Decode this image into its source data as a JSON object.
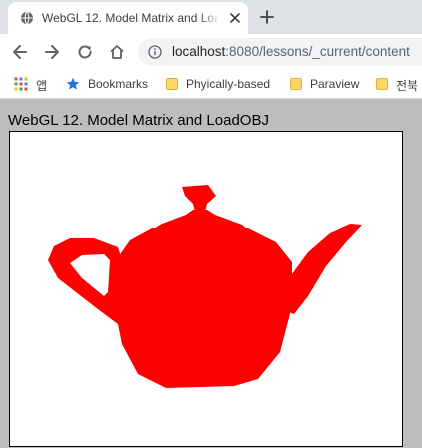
{
  "browser": {
    "tab": {
      "title": "WebGL 12. Model Matrix and LoadOBJ",
      "favicon": "globe-icon",
      "close": "close-icon"
    },
    "new_tab": "plus-icon",
    "toolbar": {
      "back": "arrow-left-icon",
      "forward": "arrow-right-icon",
      "reload": "reload-icon",
      "home": "home-icon",
      "site_info": "info-icon"
    },
    "url": {
      "host": "localhost",
      "rest": ":8080/lessons/_current/content"
    },
    "bookmarks": [
      {
        "label": "앱",
        "icon": "apps-grid-icon"
      },
      {
        "label": "Bookmarks",
        "icon": "star-icon"
      },
      {
        "label": "Phyically-based",
        "icon": "folder-icon"
      },
      {
        "label": "Paraview",
        "icon": "folder-icon"
      },
      {
        "label": "전북",
        "icon": "folder-icon"
      }
    ]
  },
  "page": {
    "heading": "WebGL 12. Model Matrix and LoadOBJ",
    "canvas": {
      "background": "#ffffff",
      "model": "teapot",
      "model_color": "#ff0000"
    },
    "background": "#bdbdbd"
  }
}
